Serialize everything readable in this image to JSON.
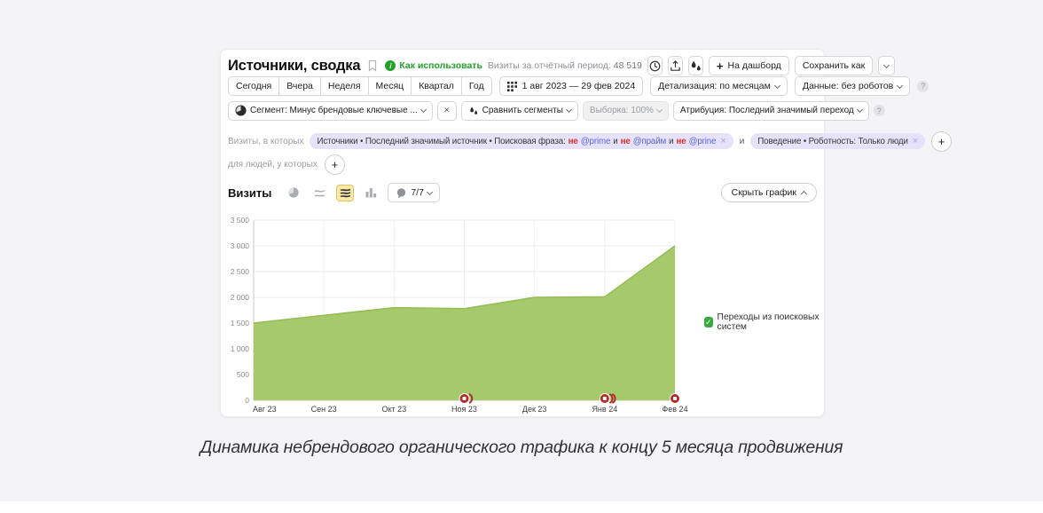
{
  "icons": {
    "plus": "+",
    "close": "×",
    "question": "?",
    "check": "✓",
    "info": "i"
  },
  "header": {
    "title": "Источники, сводка",
    "how_to_use": "Как использовать",
    "visits_label": "Визиты за отчётный период:",
    "visits_value": "48 519",
    "dashboard_label": "На дашборд",
    "save_as_label": "Сохранить как"
  },
  "period": {
    "tabs": [
      "Сегодня",
      "Вчера",
      "Неделя",
      "Месяц",
      "Квартал",
      "Год"
    ],
    "date_range": "1 авг 2023 — 29 фев 2024",
    "detalization": "Детализация: по месяцам",
    "data_filter": "Данные: без роботов"
  },
  "segment": {
    "segment_label": "Сегмент: Минус брендовые ключевые ...",
    "compare_label": "Сравнить сегменты",
    "sampling_label": "Выборка: 100%",
    "attribution_label": "Атрибуция: Последний значимый переход"
  },
  "filters": {
    "visits_prefix": "Визиты, в которых",
    "source_chip": {
      "text": "Источники • Последний значимый источник • Поисковая фраза:",
      "neg": "не",
      "and": "и",
      "terms": [
        "@prime",
        "@прайм",
        "@prine"
      ]
    },
    "joiner": "и",
    "behavior_chip": "Поведение • Роботность: Только люди",
    "people_prefix": "для людей, у которых"
  },
  "chartbar": {
    "metric_label": "Визиты",
    "comments_label": "7/7",
    "hide_label": "Скрыть график"
  },
  "chart_data": {
    "type": "area",
    "title": "",
    "x": [
      "Авг 23",
      "Сен 23",
      "Окт 23",
      "Ноя 23",
      "Дек 23",
      "Янв 24",
      "Фев 24"
    ],
    "series": [
      {
        "name": "Переходы из поисковых систем",
        "values": [
          1500,
          1650,
          1800,
          1780,
          2000,
          2010,
          3000
        ]
      }
    ],
    "ylim": [
      0,
      3500
    ],
    "ytick_step": 500,
    "ytick_labels": [
      "0",
      "500",
      "1 000",
      "1 500",
      "2 000",
      "2 500",
      "3 000",
      "3 500"
    ],
    "grid": true,
    "legend_position": "right",
    "fill_color": "#a5c96b",
    "stroke_color": "#94bd55",
    "marker_color": "#b32c2c",
    "annotations": [
      {
        "x": "Ноя 23",
        "comments": 2
      },
      {
        "x": "Янв 24",
        "comments": 3
      },
      {
        "x": "Фев 24",
        "comments": 1
      }
    ]
  },
  "page": {
    "caption": "Динамика небрендового органического трафика к концу 5 месяца продвижения"
  }
}
